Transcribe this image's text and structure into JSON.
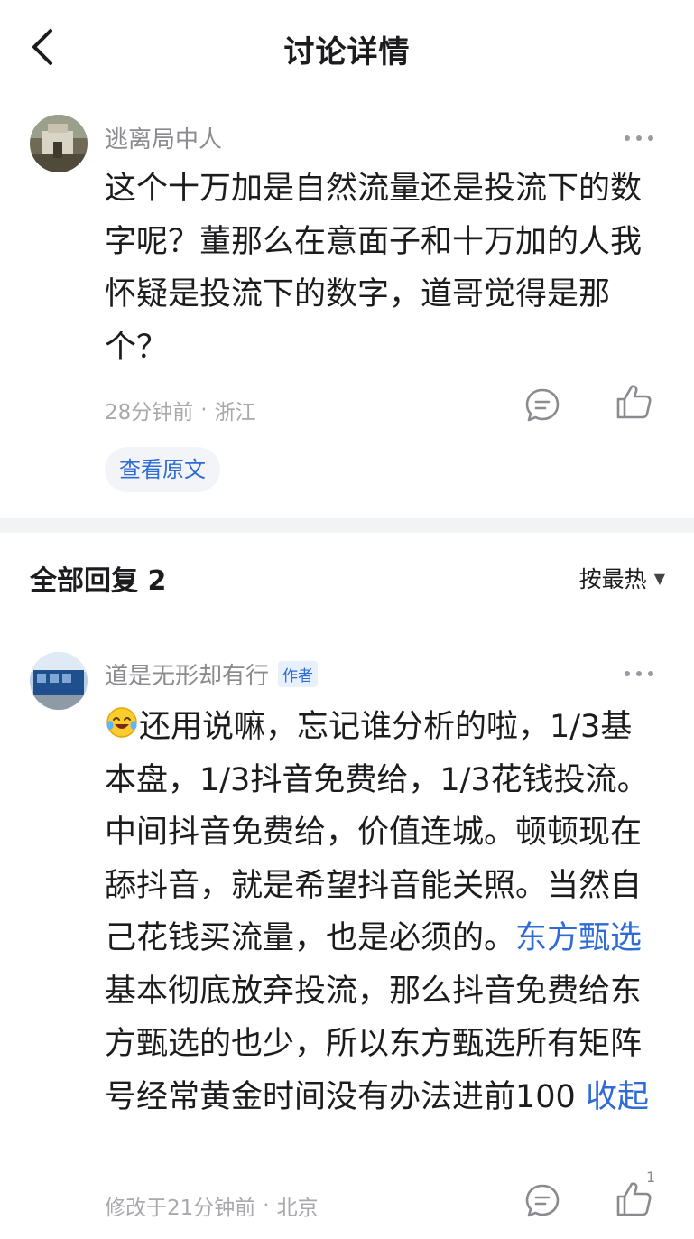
{
  "header": {
    "title": "讨论详情"
  },
  "post": {
    "author": "逃离局中人",
    "content": "这个十万加是自然流量还是投流下的数字呢？董那么在意面子和十万加的人我怀疑是投流下的数字，道哥觉得是那个？",
    "time": "28分钟前",
    "location": "浙江",
    "separator": "·",
    "view_original": "查看原文"
  },
  "replies": {
    "title": "全部回复 2",
    "sort_label": "按最热",
    "items": [
      {
        "author": "道是无形却有行",
        "badge": "作者",
        "text_part1": "还用说嘛，忘记谁分析的啦，1/3基本盘，1/3抖音免费给，1/3花钱投流。中间抖音免费给，价值连城。顿顿现在舔抖音，就是希望抖音能关照。当然自己花钱买流量，也是必须的。",
        "link_text": "东方甄选",
        "text_part2": "基本彻底放弃投流，那么抖音免费给东方甄选的也少，所以东方甄选所有矩阵号经常黄金时间没有办法进前100 ",
        "collapse": "收起",
        "meta": "修改于21分钟前",
        "separator": "·",
        "location": "北京",
        "like_count": "1"
      }
    ]
  },
  "colors": {
    "accent": "#2e6bd6",
    "muted": "#8a8a8f",
    "band": "#f2f3f5"
  },
  "icons": [
    "back-arrow-icon",
    "more-dots-icon",
    "comment-icon",
    "thumbs-up-icon",
    "caret-down-icon",
    "laughing-tears-emoji-icon"
  ]
}
